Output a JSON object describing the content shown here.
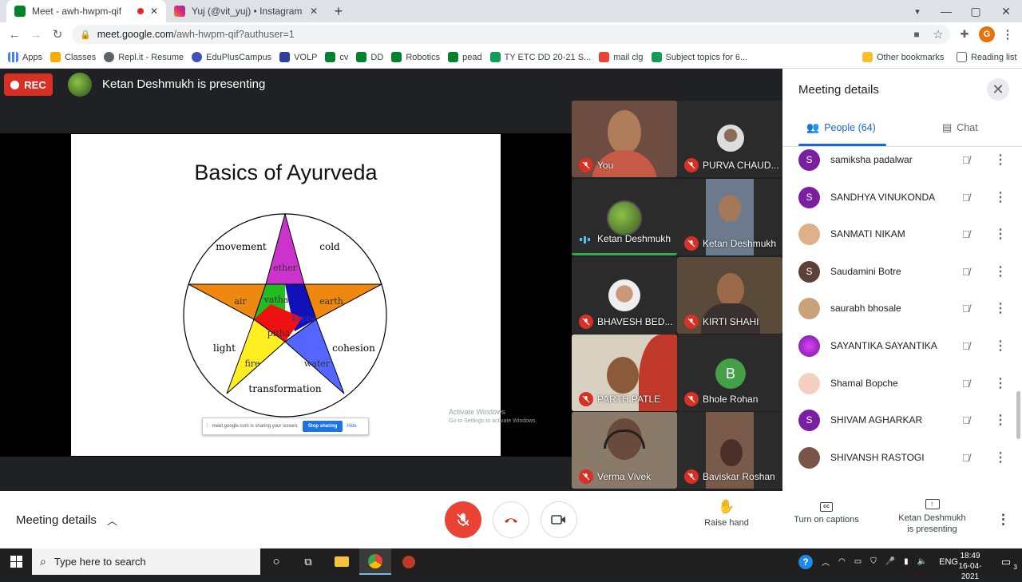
{
  "browser": {
    "tabs": [
      {
        "title": "Meet - awh-hwpm-qif",
        "favicon_color": "#00832d"
      },
      {
        "title": "Yuj (@vit_yuj) • Instagram photos",
        "favicon_color": "#e1306c"
      }
    ],
    "url_host": "meet.google.com",
    "url_path": "/awh-hwpm-qif?authuser=1",
    "profile_initial": "G",
    "bookmarks": [
      {
        "label": "Apps",
        "icon": "apps-grid-icon",
        "color": "#4285f4"
      },
      {
        "label": "Classes",
        "icon": "classroom-icon",
        "color": "#f9ab00"
      },
      {
        "label": "Repl.it - Resume",
        "icon": "replit-icon",
        "color": "#5f6368"
      },
      {
        "label": "EduPlusCampus",
        "icon": "eduplus-icon",
        "color": "#3f51b5"
      },
      {
        "label": "VOLP",
        "icon": "volp-icon",
        "color": "#303f9f"
      },
      {
        "label": "cv",
        "icon": "meet-icon",
        "color": "#00832d"
      },
      {
        "label": "DD",
        "icon": "meet-icon",
        "color": "#00832d"
      },
      {
        "label": "Robotics",
        "icon": "meet-icon",
        "color": "#00832d"
      },
      {
        "label": "pead",
        "icon": "meet-icon",
        "color": "#00832d"
      },
      {
        "label": "TY ETC DD 20-21 S...",
        "icon": "sheets-icon",
        "color": "#0f9d58"
      },
      {
        "label": "mail clg",
        "icon": "gmail-icon",
        "color": "#ea4335"
      },
      {
        "label": "Subject topics for 6...",
        "icon": "sheets-icon",
        "color": "#0f9d58"
      }
    ],
    "other_bookmarks": "Other bookmarks",
    "reading_list": "Reading list"
  },
  "meet": {
    "rec_label": "REC",
    "presenting_banner": "Ketan Deshmukh is presenting",
    "slide": {
      "title": "Basics of Ayurveda",
      "labels": {
        "movement": "movement",
        "cold": "cold",
        "ether": "ether",
        "air": "air",
        "vatha": "vatha",
        "earth": "earth",
        "kapha": "kapha",
        "pitha": "pitha",
        "light": "light",
        "cohesion": "cohesion",
        "fire": "fire",
        "water": "water",
        "transformation": "transformation"
      },
      "share_bar": {
        "message": "meet.google.com is sharing your screen.",
        "stop": "Stop sharing",
        "hide": "Hide"
      }
    },
    "watermark": {
      "line1": "Activate Windows",
      "line2": "Go to Settings to activate Windows."
    },
    "tiles": [
      {
        "name": "You",
        "muted": true,
        "bg": "#6d4c41"
      },
      {
        "name": "PURVA CHAUD...",
        "muted": true,
        "bg": "#2b2b2b"
      },
      {
        "name": "Ketan Deshmukh",
        "muted": false,
        "bg": "#2b2b2b"
      },
      {
        "name": "Ketan Deshmukh",
        "muted": true,
        "bg": "#6b7a8c"
      },
      {
        "name": "BHAVESH BED...",
        "muted": true,
        "bg": "#2b2b2b"
      },
      {
        "name": "KIRTI SHAHI",
        "muted": true,
        "bg": "#5a4a3a"
      },
      {
        "name": "PARTH PATLE",
        "muted": true,
        "bg": "#d8d0c0"
      },
      {
        "name": "Bhole Rohan",
        "muted": true,
        "bg": "#2b2b2b",
        "initial": "B"
      },
      {
        "name": "Verma Vivek",
        "muted": true,
        "bg": "#8a7a6a"
      },
      {
        "name": "Baviskar Roshan",
        "muted": true,
        "bg": "#2b2b2b"
      }
    ],
    "panel": {
      "title": "Meeting details",
      "people_tab": "People (64)",
      "chat_tab": "Chat",
      "people": [
        {
          "name": "samiksha padalwar",
          "initial": "S",
          "color": "#7b1fa2"
        },
        {
          "name": "SANDHYA VINUKONDA",
          "initial": "S",
          "color": "#7b1fa2"
        },
        {
          "name": "SANMATI NIKAM",
          "initial": "",
          "color": "#e0b08a"
        },
        {
          "name": "Saudamini Botre",
          "initial": "S",
          "color": "#5d4037"
        },
        {
          "name": "saurabh bhosale",
          "initial": "",
          "color": "#c9a27a"
        },
        {
          "name": "SAYANTIKA SAYANTIKA",
          "initial": "",
          "color": "#9c27b0"
        },
        {
          "name": "Shamal Bopche",
          "initial": "",
          "color": "#e57373"
        },
        {
          "name": "SHIVAM AGHARKAR",
          "initial": "S",
          "color": "#7b1fa2"
        },
        {
          "name": "SHIVANSH RASTOGI",
          "initial": "",
          "color": "#795548"
        }
      ]
    },
    "bottom": {
      "meeting_details": "Meeting details",
      "raise_hand": "Raise hand",
      "captions": "Turn on captions",
      "presenting_line1": "Ketan Deshmukh",
      "presenting_line2": "is presenting"
    }
  },
  "taskbar": {
    "search_placeholder": "Type here to search",
    "lang": "ENG",
    "time": "18:49",
    "date": "16-04-2021",
    "notifications": "3"
  }
}
